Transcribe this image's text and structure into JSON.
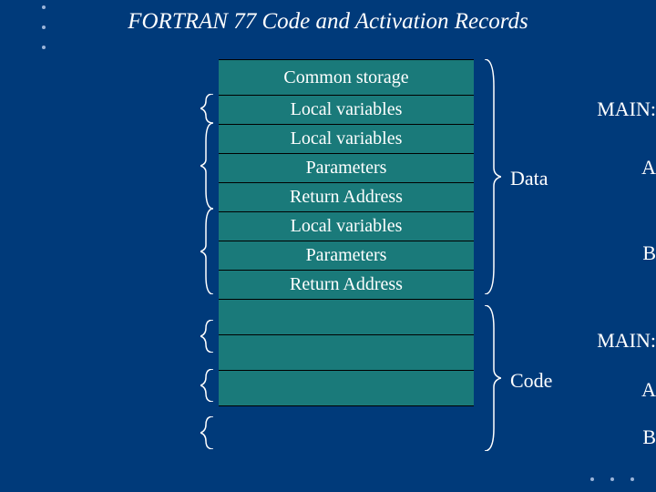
{
  "title": "FORTRAN 77 Code and Activation Records",
  "labels": {
    "main": "MAIN:",
    "a": "A",
    "b": "B",
    "main2": "MAIN:",
    "a2": "A",
    "b2": "B",
    "data": "Data",
    "code": "Code"
  },
  "cells": {
    "common": "Common storage",
    "lv1": "Local variables",
    "lv2": "Local variables",
    "par1": "Parameters",
    "ret1": "Return Address",
    "lv3": "Local variables",
    "par2": "Parameters",
    "ret2": "Return Address"
  }
}
